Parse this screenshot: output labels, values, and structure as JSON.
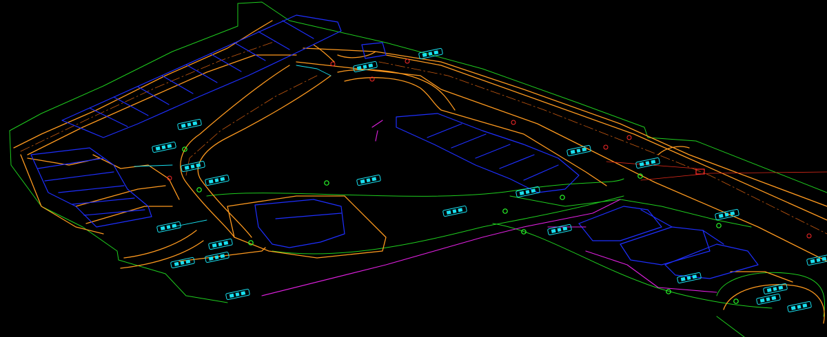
{
  "drawing": {
    "background": "#000000",
    "layer_colors": {
      "roads": "#ff9a1f",
      "road_centerline": "#c85a10",
      "parcel_boundary": "#1fcf1f",
      "buildings": "#1e2fff",
      "vehicles": "#18e0f0",
      "utility_lines": "#e020e0",
      "markers": "#ff2a2a",
      "control_points": "#2aff2a"
    },
    "icons": [
      "car-icon",
      "survey-marker-icon",
      "control-point-icon"
    ]
  }
}
